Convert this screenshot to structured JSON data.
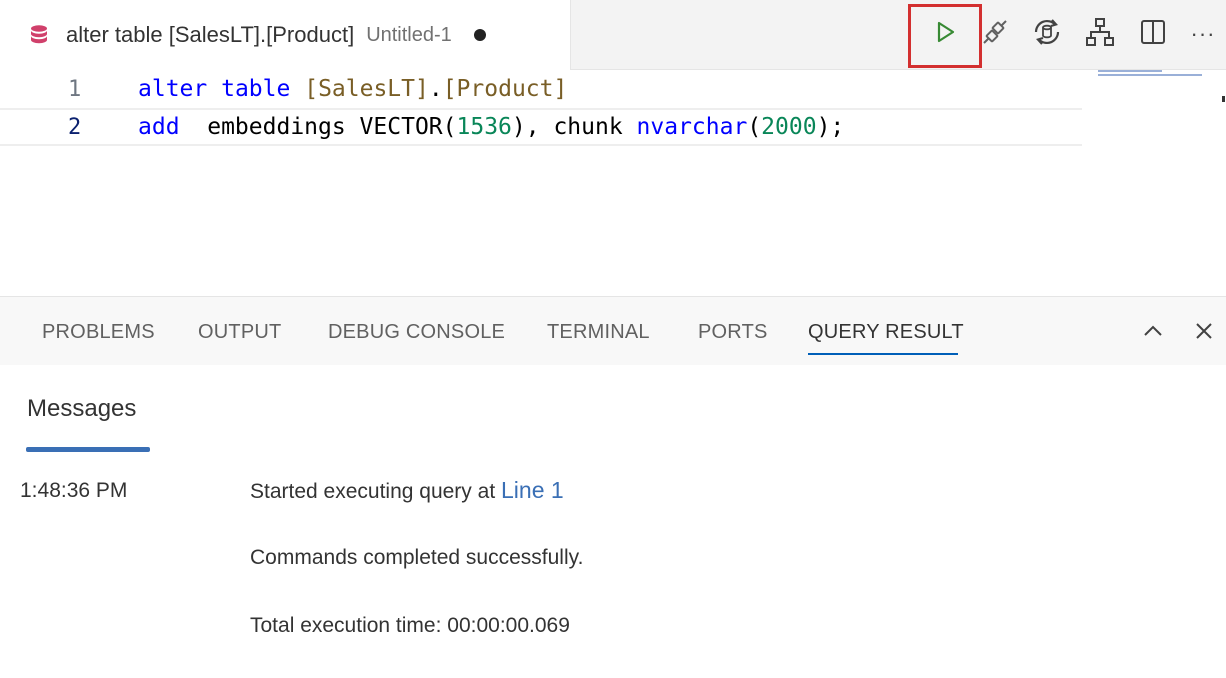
{
  "tab": {
    "title": "alter table [SalesLT].[Product]",
    "description": "Untitled-1",
    "dirty": true,
    "icon": "database-icon"
  },
  "toolbar": {
    "run": "run-query-icon",
    "connect": "connect-icon",
    "change_connection": "change-connection-icon",
    "query_plan": "query-plan-icon",
    "split": "split-editor-icon",
    "more": "···"
  },
  "editor": {
    "lines": [
      {
        "number": "1",
        "tokens": [
          {
            "t": "alter",
            "c": "kw"
          },
          {
            "t": " ",
            "c": "plain"
          },
          {
            "t": "table",
            "c": "kw"
          },
          {
            "t": " ",
            "c": "plain"
          },
          {
            "t": "[SalesLT]",
            "c": "fn"
          },
          {
            "t": ".",
            "c": "plain"
          },
          {
            "t": "[Product]",
            "c": "fn"
          }
        ]
      },
      {
        "number": "2",
        "tokens": [
          {
            "t": "add",
            "c": "kw"
          },
          {
            "t": "  embeddings VECTOR",
            "c": "plain"
          },
          {
            "t": "(",
            "c": "plain"
          },
          {
            "t": "1536",
            "c": "num"
          },
          {
            "t": "), chunk ",
            "c": "plain"
          },
          {
            "t": "nvarchar",
            "c": "kw"
          },
          {
            "t": "(",
            "c": "plain"
          },
          {
            "t": "2000",
            "c": "num"
          },
          {
            "t": ");",
            "c": "plain"
          }
        ]
      }
    ]
  },
  "panel": {
    "tabs": [
      "PROBLEMS",
      "OUTPUT",
      "DEBUG CONSOLE",
      "TERMINAL",
      "PORTS",
      "QUERY RESULT"
    ],
    "active_tab": "QUERY RESULT",
    "section_title": "Messages",
    "timestamp": "1:48:36 PM",
    "messages": {
      "started": "Started executing query at ",
      "line_link": "Line 1",
      "completed": "Commands completed successfully.",
      "execution_time": "Total execution time: 00:00:00.069"
    }
  },
  "colors": {
    "keyword": "#0000ff",
    "number": "#098658",
    "bracket": "#795e26",
    "accent": "#005fb8",
    "run": "#388a34",
    "highlight": "#d32f2f",
    "db_icon": "#d0406b"
  }
}
